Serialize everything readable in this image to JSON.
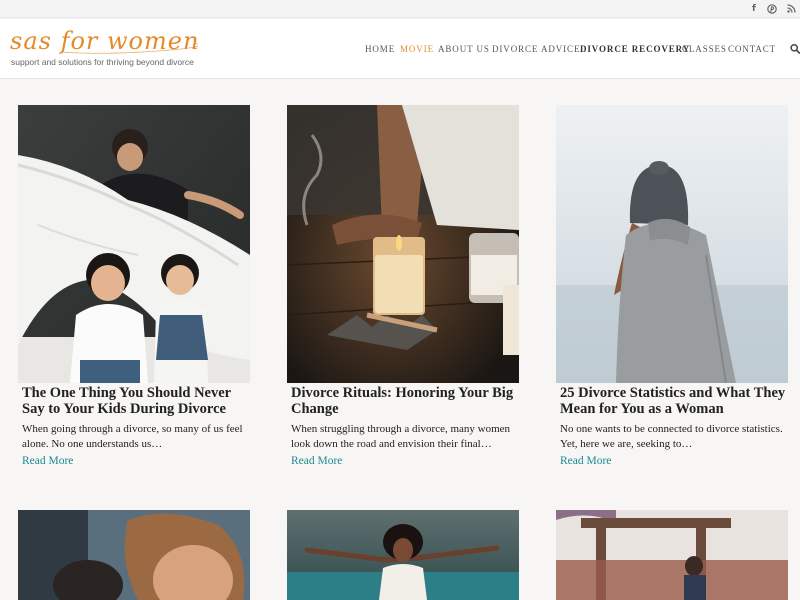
{
  "site": {
    "logo": "sas for women",
    "tagline": "support and solutions for thriving beyond divorce"
  },
  "social": {
    "facebook": "f",
    "pinterest": "℗",
    "rss": "⧸"
  },
  "nav": {
    "items": [
      {
        "label": "HOME"
      },
      {
        "label": "MOVIE"
      },
      {
        "label": "ABOUT US"
      },
      {
        "label": "DIVORCE ADVICE"
      },
      {
        "label": "DIVORCE RECOVERY"
      },
      {
        "label": "CLASSES"
      },
      {
        "label": "CONTACT"
      }
    ],
    "active_color": "#e38b2b"
  },
  "posts": [
    {
      "title": "The One Thing You Should Never Say to Your Kids During Divorce",
      "excerpt": "When going through a divorce, so many of us feel alone. No one understands us…",
      "link": "Read More"
    },
    {
      "title": "Divorce Rituals: Honoring Your Big Change",
      "excerpt": "When struggling through a divorce, many women look down the road and envision their final…",
      "link": "Read More"
    },
    {
      "title": "25 Divorce Statistics and What They Mean for You as a Woman",
      "excerpt": "No one wants to be connected to divorce statistics. Yet, here we are, seeking to…",
      "link": "Read More"
    }
  ],
  "colors": {
    "accent": "#e38b2b",
    "link": "#1a8a93",
    "background": "#f7f6f4"
  }
}
